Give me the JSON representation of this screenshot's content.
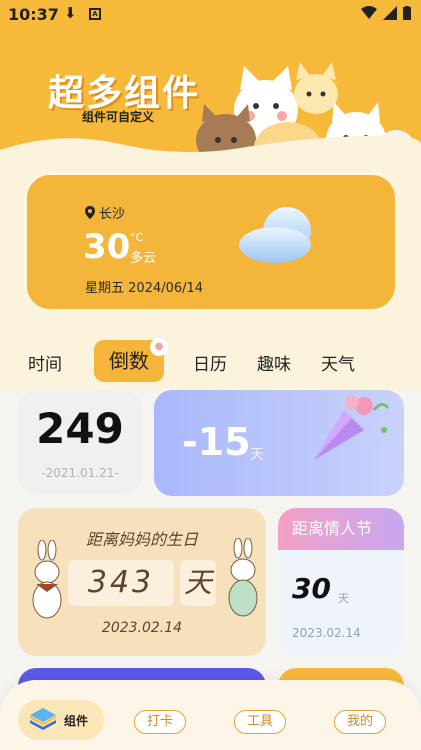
{
  "status": {
    "time": "10:37"
  },
  "banner": {
    "title": "超多组件",
    "subtitle": "组件可自定义"
  },
  "weather": {
    "location": "长沙",
    "temperature": "30",
    "unit": "°C",
    "condition": "多云",
    "date": "星期五 2024/06/14"
  },
  "tabs": [
    "时间",
    "倒数",
    "日历",
    "趣味",
    "天气"
  ],
  "active_tab": "倒数",
  "cards": {
    "countdown_1": {
      "value": "249",
      "date": "-2021.01.21-"
    },
    "countdown_2": {
      "value": "-15",
      "unit": "天"
    },
    "mom_birthday": {
      "title": "距离妈妈的生日",
      "days": "343",
      "unit": "天",
      "date": "2023.02.14"
    },
    "valentine": {
      "title": "距离情人节",
      "value": "30",
      "unit": "天",
      "date": "2023.02.14"
    }
  },
  "bottom_nav": {
    "widgets": "组件",
    "checkin": "打卡",
    "tools": "工具",
    "mine": "我的"
  }
}
